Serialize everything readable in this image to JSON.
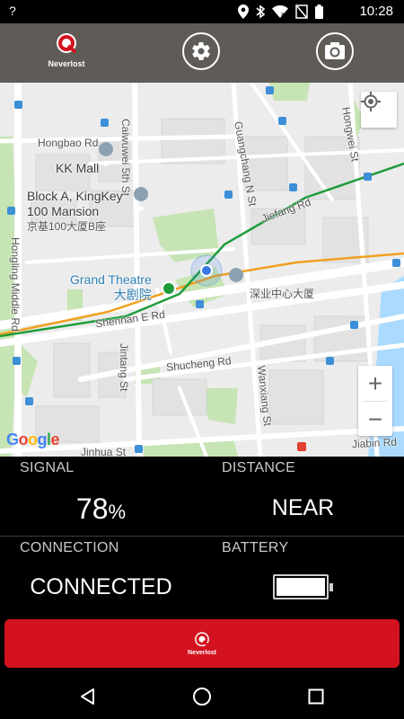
{
  "status_bar": {
    "unknown_sim": "?",
    "time": "10:28",
    "icons": [
      "location-icon",
      "bluetooth-icon",
      "wifi-icon",
      "no-sim-icon",
      "battery-icon"
    ]
  },
  "toolbar": {
    "logo_text": "Neverlost",
    "settings_icon": "gear-icon",
    "camera_icon": "camera-icon"
  },
  "map": {
    "streets": {
      "hongbao": "Hongbao Rd",
      "caiwuwei": "Caiwuwei 5th St",
      "guangchang": "Guangchang N St",
      "hongwei": "Hongwei St",
      "jiefang": "Jiefang Rd",
      "hongling": "Hongling Middle Rd",
      "shennan": "Shennan E Rd",
      "jintang": "Jintang St",
      "shucheng": "Shucheng Rd",
      "wanxiang": "Wanxiang St",
      "jinhua": "Jinhua St",
      "jiabin": "Jiabin Rd"
    },
    "places": {
      "kk_mall": "KK Mall",
      "block_a_line1": "Block A, KingKey",
      "block_a_line2": "100 Mansion",
      "block_a_cn": "京基100大厦B座",
      "grand_theatre": "Grand Theatre",
      "grand_theatre_cn": "大剧院",
      "shenye": "深业中心大厦"
    },
    "google_logo": "Google",
    "zoom_in": "+",
    "zoom_out": "−",
    "colors": {
      "green_line": "#1e9c3a",
      "orange_line": "#f0a020",
      "park": "#c7e4b4",
      "water": "#aadaff"
    }
  },
  "stats": {
    "signal_label": "SIGNAL",
    "signal_value": "78",
    "signal_unit": "%",
    "distance_label": "DISTANCE",
    "distance_value": "NEAR",
    "connection_label": "CONNECTION",
    "connection_value": "CONNECTED",
    "battery_label": "BATTERY",
    "battery_level": 1.0
  },
  "action_button": {
    "logo_text": "Neverlost",
    "color": "#d4121f"
  },
  "nav_bar": {
    "back": "back-icon",
    "home": "home-icon",
    "recents": "recents-icon"
  }
}
